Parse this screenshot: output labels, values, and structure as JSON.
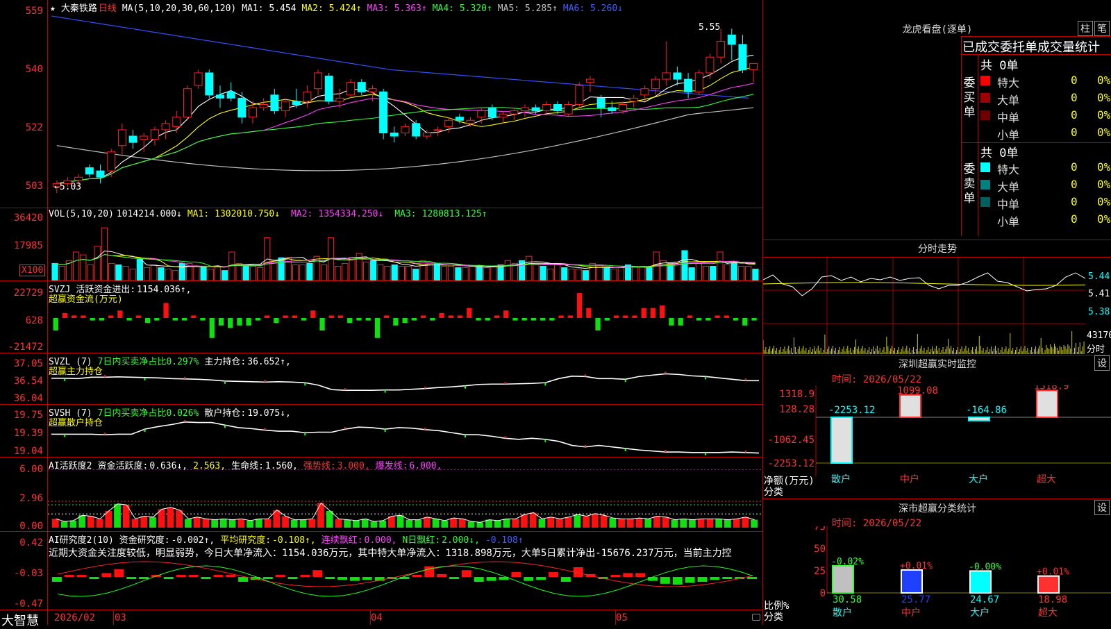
{
  "header": {
    "star": "★",
    "stock_name": "大秦铁路",
    "period": "日线",
    "ma_label": "MA(5,10,20,30,60,120)",
    "ma": [
      {
        "name": "MA1:",
        "value": "5.454",
        "color": "#ffffff"
      },
      {
        "name": "MA2:",
        "value": "5.424↑",
        "color": "#ffff00"
      },
      {
        "name": "MA3:",
        "value": "5.363↑",
        "color": "#ff40ff"
      },
      {
        "name": "MA4:",
        "value": "5.320↑",
        "color": "#30ff30"
      },
      {
        "name": "MA5:",
        "value": "5.285↑",
        "color": "#c0c0c0"
      },
      {
        "name": "MA6:",
        "value": "5.260↓",
        "color": "#4060ff"
      }
    ]
  },
  "price_axis": [
    "559",
    "540",
    "522",
    "503"
  ],
  "price_annotations": {
    "high": "5.55",
    "low": "5.03"
  },
  "volume": {
    "label": "VOL(5,10,20)",
    "value": "1014214.000↓",
    "ma": [
      {
        "name": "MA1:",
        "value": "1302010.750↓"
      },
      {
        "name": "MA2:",
        "value": "1354334.250↓"
      },
      {
        "name": "MA3:",
        "value": "1280813.125↑"
      }
    ],
    "axis": [
      "36420",
      "17985",
      "X100"
    ]
  },
  "svzj": {
    "label": "SVZJ",
    "text": "活跃资金进出:",
    "value": "1154.036↑,",
    "subtitle": "超赢资金流(万元)",
    "axis": [
      "22729",
      "628",
      "-21472"
    ]
  },
  "svzl": {
    "label": "SVZL (7)",
    "text": "7日内买卖净占比0.297%",
    "text2": "主力持仓:",
    "value": "36.652↑,",
    "subtitle": "超赢主力持仓",
    "axis": [
      "37.05",
      "36.54",
      "36.04"
    ]
  },
  "svsh": {
    "label": "SVSH (7)",
    "text": "7日内买卖净占比0.026%",
    "text2": "散户持仓:",
    "value": "19.075↓,",
    "subtitle": "超赢散户持仓",
    "axis": [
      "19.75",
      "19.39",
      "19.04"
    ]
  },
  "ai_active": {
    "label": "AI活跃度2",
    "t1": "资金活跃度:",
    "v1": "0.636↓,",
    "v2": "2.563,",
    "t3": "生命线:",
    "v3": "1.560,",
    "t4": "强势线:",
    "v4": "3.000,",
    "t5": "爆发线:",
    "v5": "6.000,",
    "axis": [
      "6.00",
      "2.96",
      "0.00"
    ]
  },
  "ai_research": {
    "label": "AI研究度2(10)",
    "t1": "资金研究度:",
    "v1": "-0.002↑,",
    "t2": "平均研究度:",
    "v2": "-0.108↑,",
    "t3": "连续飘红:",
    "v3": "0.000,",
    "t4": "N日飘红:",
    "v4": "2.000↓,",
    "v5": "-0.108↑",
    "comment": "近期大资金关注度较低，明显弱势，今日大单净流入：1154.036万元，其中特大单净流入：1318.898万元，大单5日累计净出-15676.237万元，当前主力控",
    "axis": [
      "0.42",
      "-0.03",
      "-0.47"
    ]
  },
  "bottom": {
    "brand": "大智慧",
    "dates": [
      "2026/02",
      "03",
      "04",
      "05"
    ]
  },
  "lhb": {
    "title": "龙虎看盘(逐单)",
    "btn1": "柱",
    "btn2": "笔",
    "subtitle": "已成交委托单成交量统计",
    "buy_label": "委买单",
    "sell_label": "委卖单",
    "buy_total": "共 0单",
    "sell_total": "共 0单",
    "buy_rows": [
      {
        "name": "特大",
        "v": "0",
        "p": "0%",
        "color": "#ff0000"
      },
      {
        "name": "大单",
        "v": "0",
        "p": "0%",
        "color": "#a00000"
      },
      {
        "name": "中单",
        "v": "0",
        "p": "0%",
        "color": "#700000"
      },
      {
        "name": "小单",
        "v": "0",
        "p": "0%",
        "color": ""
      }
    ],
    "sell_rows": [
      {
        "name": "特大",
        "v": "0",
        "p": "0%",
        "color": "#00ffff"
      },
      {
        "name": "大单",
        "v": "0",
        "p": "0%",
        "color": "#008080"
      },
      {
        "name": "中单",
        "v": "0",
        "p": "0%",
        "color": "#006060"
      },
      {
        "name": "小单",
        "v": "0",
        "p": "0%",
        "color": ""
      }
    ]
  },
  "intraday": {
    "title": "分时走势",
    "axis": [
      "5.44",
      "5.41",
      "5.38"
    ],
    "vol_axis": [
      "43170",
      "分时"
    ]
  },
  "sz_monitor": {
    "title": "深圳超赢实时监控",
    "btn": "设",
    "time": "时间: 2026/05/22",
    "axis": [
      "1318.9",
      "128.28",
      "-1062.45",
      "-2253.12"
    ],
    "unit": "净额(万元)",
    "cat_label": "分类",
    "categories": [
      "散户",
      "中户",
      "大户",
      "超大"
    ],
    "values": [
      -2253.12,
      1099.08,
      -164.86,
      1318.9
    ],
    "value_labels": [
      "-2253.12",
      "1099.08",
      "-164.86",
      "1318.9"
    ]
  },
  "sz_class": {
    "title": "深市超赢分类统计",
    "btn": "设",
    "time": "时间: 2026/05/22",
    "axis": [
      "75",
      "50",
      "25",
      "0"
    ],
    "unit": "比例%",
    "cat_label": "分类",
    "categories": [
      "散户",
      "中户",
      "大户",
      "超大"
    ],
    "values": [
      30.58,
      25.77,
      24.67,
      18.98
    ],
    "changes": [
      "-0.02%",
      "+0.01%",
      "-0.00%",
      "+0.01%"
    ]
  },
  "chart_data": [
    {
      "type": "candlestick",
      "title": "大秦铁路 日线",
      "ylim": [
        5.03,
        5.59
      ],
      "yticks": [
        5.59,
        5.4,
        5.22,
        5.03
      ],
      "x_labels": [
        "2026/02",
        "03",
        "04",
        "05"
      ],
      "ohlc": [
        [
          5.05,
          5.07,
          5.03,
          5.06
        ],
        [
          5.06,
          5.08,
          5.05,
          5.07
        ],
        [
          5.07,
          5.09,
          5.05,
          5.08
        ],
        [
          5.11,
          5.12,
          5.08,
          5.09
        ],
        [
          5.1,
          5.12,
          5.06,
          5.08
        ],
        [
          5.1,
          5.17,
          5.08,
          5.16
        ],
        [
          5.18,
          5.25,
          5.15,
          5.23
        ],
        [
          5.21,
          5.23,
          5.17,
          5.19
        ],
        [
          5.2,
          5.22,
          5.16,
          5.21
        ],
        [
          5.2,
          5.24,
          5.18,
          5.23
        ],
        [
          5.23,
          5.26,
          5.2,
          5.25
        ],
        [
          5.24,
          5.29,
          5.22,
          5.27
        ],
        [
          5.27,
          5.37,
          5.26,
          5.36
        ],
        [
          5.37,
          5.42,
          5.36,
          5.41
        ],
        [
          5.41,
          5.42,
          5.33,
          5.34
        ],
        [
          5.34,
          5.37,
          5.3,
          5.33
        ],
        [
          5.35,
          5.38,
          5.32,
          5.33
        ],
        [
          5.33,
          5.35,
          5.25,
          5.27
        ],
        [
          5.27,
          5.32,
          5.25,
          5.3
        ],
        [
          5.3,
          5.33,
          5.29,
          5.31
        ],
        [
          5.34,
          5.36,
          5.28,
          5.29
        ],
        [
          5.29,
          5.33,
          5.27,
          5.32
        ],
        [
          5.32,
          5.36,
          5.3,
          5.31
        ],
        [
          5.32,
          5.37,
          5.3,
          5.35
        ],
        [
          5.36,
          5.42,
          5.34,
          5.41
        ],
        [
          5.4,
          5.41,
          5.31,
          5.32
        ],
        [
          5.32,
          5.36,
          5.3,
          5.33
        ],
        [
          5.34,
          5.39,
          5.33,
          5.38
        ],
        [
          5.38,
          5.39,
          5.34,
          5.35
        ],
        [
          5.35,
          5.37,
          5.32,
          5.36
        ],
        [
          5.35,
          5.36,
          5.2,
          5.22
        ],
        [
          5.22,
          5.24,
          5.19,
          5.21
        ],
        [
          5.22,
          5.25,
          5.21,
          5.24
        ],
        [
          5.25,
          5.26,
          5.2,
          5.21
        ],
        [
          5.21,
          5.23,
          5.2,
          5.22
        ],
        [
          5.23,
          5.24,
          5.21,
          5.23
        ],
        [
          5.24,
          5.27,
          5.22,
          5.26
        ],
        [
          5.27,
          5.28,
          5.25,
          5.26
        ],
        [
          5.25,
          5.27,
          5.24,
          5.26
        ],
        [
          5.27,
          5.3,
          5.25,
          5.29
        ],
        [
          5.3,
          5.31,
          5.26,
          5.27
        ],
        [
          5.27,
          5.29,
          5.25,
          5.28
        ],
        [
          5.28,
          5.3,
          5.26,
          5.29
        ],
        [
          5.29,
          5.31,
          5.27,
          5.3
        ],
        [
          5.3,
          5.31,
          5.28,
          5.29
        ],
        [
          5.29,
          5.32,
          5.28,
          5.31
        ],
        [
          5.31,
          5.32,
          5.28,
          5.29
        ],
        [
          5.28,
          5.32,
          5.27,
          5.31
        ],
        [
          5.31,
          5.38,
          5.3,
          5.37
        ],
        [
          5.38,
          5.4,
          5.35,
          5.39
        ],
        [
          5.33,
          5.34,
          5.27,
          5.3
        ],
        [
          5.3,
          5.32,
          5.28,
          5.29
        ],
        [
          5.29,
          5.32,
          5.28,
          5.31
        ],
        [
          5.32,
          5.34,
          5.3,
          5.33
        ],
        [
          5.34,
          5.37,
          5.32,
          5.36
        ],
        [
          5.36,
          5.4,
          5.34,
          5.39
        ],
        [
          5.39,
          5.51,
          5.37,
          5.41
        ],
        [
          5.41,
          5.43,
          5.37,
          5.39
        ],
        [
          5.39,
          5.41,
          5.33,
          5.35
        ],
        [
          5.35,
          5.42,
          5.34,
          5.41
        ],
        [
          5.41,
          5.47,
          5.39,
          5.46
        ],
        [
          5.46,
          5.55,
          5.44,
          5.51
        ],
        [
          5.53,
          5.55,
          5.45,
          5.5
        ],
        [
          5.5,
          5.53,
          5.41,
          5.42
        ],
        [
          5.42,
          5.44,
          5.38,
          5.44
        ]
      ],
      "ma_lines": [
        "MA1",
        "MA2",
        "MA3",
        "MA4",
        "MA5",
        "MA6"
      ]
    },
    {
      "type": "bar",
      "title": "VOL(5,10,20)",
      "ylim": [
        0,
        40000
      ],
      "yticks": [
        36420,
        17985
      ],
      "values": [
        12,
        10,
        14,
        20,
        18,
        11,
        24,
        37,
        12,
        11,
        10,
        8,
        15,
        9,
        11,
        9,
        8,
        7,
        12,
        12,
        10,
        10,
        8,
        10,
        7,
        20,
        12,
        10,
        10,
        9,
        30,
        14,
        16,
        16,
        11,
        11,
        12,
        17,
        11,
        30,
        10,
        12,
        16,
        19,
        13,
        14,
        11,
        10,
        11,
        10,
        10,
        8,
        14,
        12,
        12,
        10,
        10,
        9,
        9,
        10,
        10,
        9,
        10,
        11,
        14,
        12,
        14,
        17,
        11,
        10,
        8,
        11,
        9,
        8,
        8,
        7,
        12,
        11,
        9,
        8,
        9,
        11,
        10,
        10,
        9,
        20,
        14,
        12,
        13,
        21,
        9,
        12,
        10,
        10,
        20,
        11,
        12,
        10,
        10,
        8
      ]
    },
    {
      "type": "bar",
      "title": "超赢资金流(万元)",
      "ylim": [
        -21472,
        22729
      ],
      "yticks": [
        22729,
        628,
        -21472
      ],
      "values": [
        -5,
        2,
        1,
        1,
        -1,
        -1,
        1,
        3,
        -1,
        1,
        -2,
        -1,
        6,
        -1,
        -1,
        1,
        -1,
        -8,
        -3,
        -4,
        -3,
        -3,
        -1,
        1,
        -2,
        1,
        1,
        -1,
        3,
        -5,
        1,
        1,
        -2,
        -1,
        -1,
        -8,
        1,
        -3,
        -2,
        -1,
        1,
        -1,
        2,
        1,
        1,
        4,
        -1,
        -1,
        1,
        3,
        -1,
        -1,
        -1,
        -1,
        -1,
        1,
        1,
        10,
        4,
        -5,
        -1,
        1,
        1,
        1,
        4,
        4,
        5,
        -3,
        -3,
        1,
        -1,
        -1,
        1,
        1,
        -1,
        -3,
        -1
      ]
    },
    {
      "type": "line",
      "title": "超赢主力持仓",
      "ylim": [
        36.04,
        37.05
      ],
      "yticks": [
        37.05,
        36.54,
        36.04
      ],
      "values": [
        36.71,
        36.71,
        36.7,
        36.74,
        36.74,
        36.75,
        36.74,
        36.73,
        36.72,
        36.7,
        36.69,
        36.68,
        36.66,
        36.63,
        36.62,
        36.61,
        36.6,
        36.61,
        36.6,
        36.58,
        36.51,
        36.38,
        36.36,
        36.36,
        36.36,
        36.37,
        36.37,
        36.39,
        36.41,
        36.44,
        36.46,
        36.49,
        36.53,
        36.54,
        36.54,
        36.55,
        36.56,
        36.58,
        36.7,
        36.77,
        36.76,
        36.7,
        36.7,
        36.68,
        36.76,
        36.8,
        36.84,
        36.82,
        36.78,
        36.76,
        36.72,
        36.68,
        36.64,
        36.64
      ]
    },
    {
      "type": "line",
      "title": "超赢散户持仓",
      "ylim": [
        19.04,
        19.75
      ],
      "yticks": [
        19.75,
        19.39,
        19.04
      ],
      "values": [
        19.43,
        19.43,
        19.43,
        19.43,
        19.42,
        19.43,
        19.43,
        19.53,
        19.58,
        19.62,
        19.67,
        19.66,
        19.66,
        19.61,
        19.56,
        19.54,
        19.51,
        19.49,
        19.49,
        19.46,
        19.47,
        19.47,
        19.53,
        19.57,
        19.56,
        19.53,
        19.56,
        19.55,
        19.52,
        19.5,
        19.46,
        19.42,
        19.42,
        19.39,
        19.35,
        19.33,
        19.35,
        19.33,
        19.29,
        19.21,
        19.18,
        19.21,
        19.18,
        19.15,
        19.12,
        19.1,
        19.08,
        19.08,
        19.07,
        19.07,
        19.07,
        19.08,
        19.07,
        19.06
      ]
    },
    {
      "type": "bar",
      "title": "AI活跃度2",
      "ylim": [
        0,
        6.0
      ],
      "yticks": [
        6.0,
        2.96,
        0.0
      ],
      "values": [
        1.0,
        0.7,
        0.8,
        1.4,
        1.3,
        1.0,
        1.9,
        2.7,
        2.6,
        1.0,
        1.3,
        1.2,
        2.1,
        2.3,
        2.0,
        1.0,
        1.2,
        1.0,
        0.9,
        1.0,
        0.9,
        1.0,
        0.8,
        1.0,
        1.0,
        2.0,
        1.3,
        0.9,
        0.9,
        1.0,
        2.8,
        1.9,
        1.0,
        0.9,
        0.8,
        1.0,
        0.7,
        0.8,
        1.3,
        1.4,
        0.9,
        0.9,
        1.2,
        1.0,
        0.8,
        1.1,
        1.0,
        0.7,
        0.6,
        0.9,
        0.8,
        1.0,
        1.0,
        1.5,
        1.7,
        1.0,
        1.2,
        1.0,
        1.2,
        1.5,
        1.3,
        1.6,
        1.4,
        1.1,
        1.0,
        1.0,
        1.1,
        1.0,
        1.3,
        1.2,
        0.9,
        1.0,
        0.9,
        1.0,
        1.0,
        1.0,
        0.9,
        1.0,
        1.2,
        0.9
      ]
    },
    {
      "type": "bar",
      "title": "AI研究度2(10)",
      "ylim": [
        -0.47,
        0.42
      ],
      "yticks": [
        0.42,
        -0.03,
        -0.47
      ],
      "values": [
        -0.05,
        0.02,
        0.01,
        -0.02,
        0.04,
        0.08,
        -0.02,
        -0.02,
        0.01,
        -0.02,
        0.01,
        0.01,
        -0.02,
        0.02,
        0.02,
        -0.05,
        -0.03,
        -0.02,
        0.01,
        -0.02,
        0.02,
        0.07,
        -0.02,
        -0.03,
        -0.04,
        -0.03,
        -0.04,
        -0.02,
        -0.02,
        0.01,
        0.11,
        0.03,
        -0.02,
        0.07,
        -0.05,
        -0.04,
        -0.03,
        0.05,
        -0.04,
        -0.03,
        0.05,
        -0.05,
        0.1,
        0.03,
        -0.01,
        0.01,
        0.04,
        0.04,
        -0.04,
        -0.07,
        -0.08,
        -0.06,
        -0.05,
        -0.03,
        -0.02,
        -0.01,
        -0.01
      ]
    }
  ]
}
